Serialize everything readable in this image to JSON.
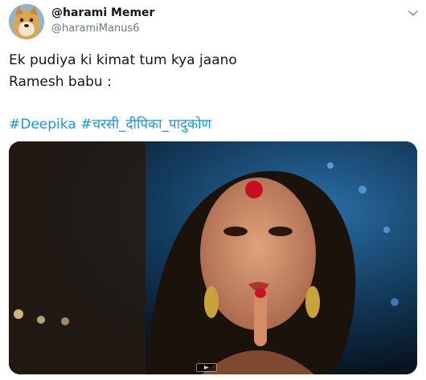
{
  "tweet": {
    "display_name": "@harami Memer",
    "handle": "@haramiManus6",
    "text_lines": [
      "Ek pudiya ki kimat tum kya jaano",
      "Ramesh babu :"
    ],
    "hashtags": [
      "#Deepika",
      "#चरसी_दीपिका_पादुकोण"
    ]
  },
  "icons": {
    "avatar": "doge-avatar",
    "more": "chevron-down-icon",
    "media_badge": "gif-badge-icon"
  },
  "colors": {
    "link": "#1b95e0",
    "secondary_text": "#657786",
    "primary_text": "#14171a"
  }
}
